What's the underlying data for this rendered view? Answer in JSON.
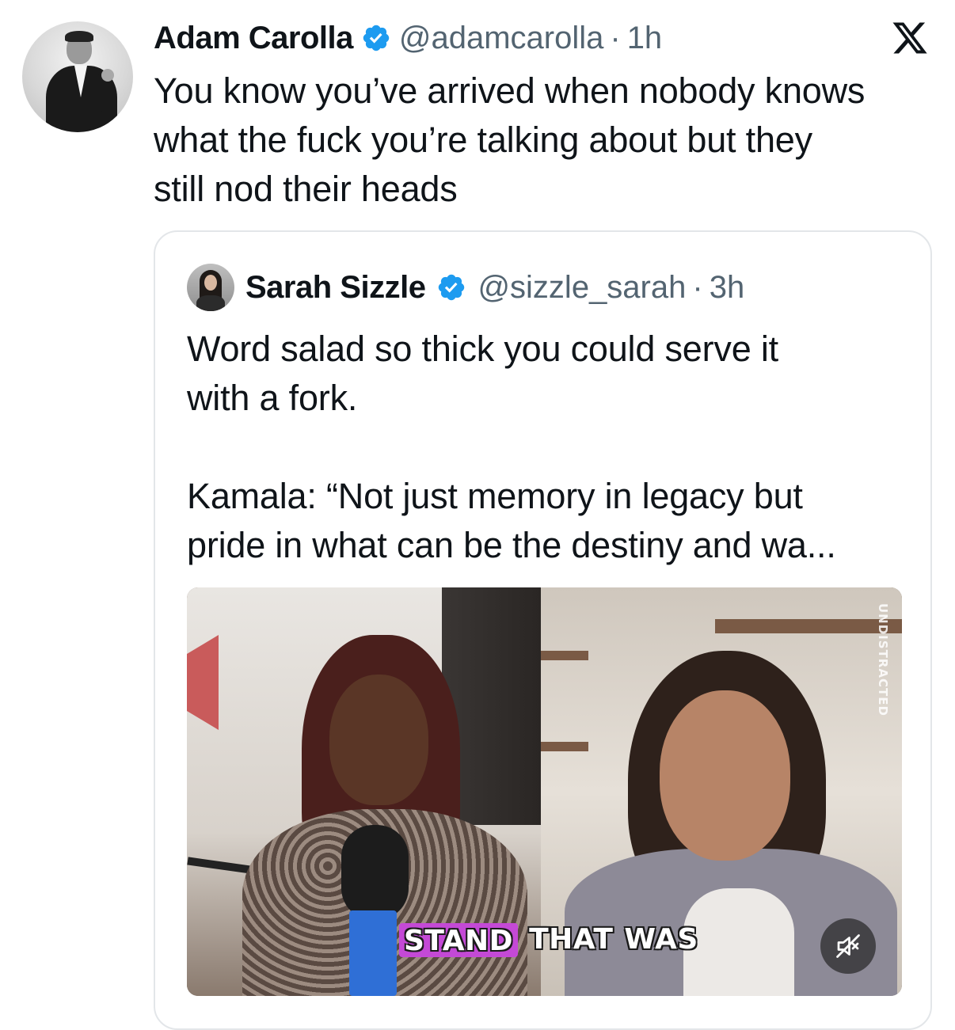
{
  "tweet": {
    "author_name": "Adam Carolla",
    "handle": "@adamcarolla",
    "separator": "·",
    "time": "1h",
    "text_lines": [
      "You know you’ve arrived when nobody knows",
      "what the fuck you’re talking about but they",
      "still nod their heads"
    ]
  },
  "quoted": {
    "author_name": "Sarah Sizzle",
    "handle": "@sizzle_sarah",
    "separator": "·",
    "time": "3h",
    "text_lines": [
      "Word salad so thick you could serve it",
      "with a fork."
    ],
    "text_lines_2": [
      "Kamala: “Not just memory in legacy but",
      "pride in what can be the destiny and wa..."
    ],
    "media": {
      "caption_words": [
        "STAND",
        "THAT",
        "WAS"
      ],
      "watermark": "UNDISTRACTED",
      "mute_icon": "speaker-muted-icon"
    }
  },
  "icons": {
    "verified": "verified-badge-icon",
    "platform": "x-logo-icon"
  },
  "colors": {
    "verified_blue": "#1d9bf0",
    "caption_highlight": "#c449d6",
    "secondary_text": "#536471"
  }
}
